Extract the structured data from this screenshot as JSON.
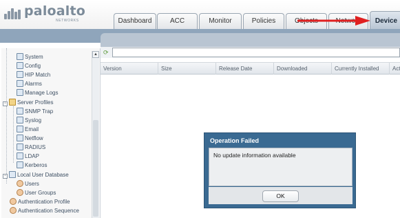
{
  "brand": {
    "name": "paloalto",
    "tagline": "NETWORKS"
  },
  "tabs": [
    "Dashboard",
    "ACC",
    "Monitor",
    "Policies",
    "Objects",
    "Network",
    "Device"
  ],
  "active_tab": "Device",
  "colors": {
    "header_band": "#8fa5bb",
    "modal": "#3a6a92",
    "annotation_arrow": "#e02020"
  },
  "sidebar": {
    "items": [
      {
        "label": "System",
        "icon": "document-icon"
      },
      {
        "label": "Config",
        "icon": "document-icon"
      },
      {
        "label": "HIP Match",
        "icon": "document-icon"
      },
      {
        "label": "Alarms",
        "icon": "document-icon"
      },
      {
        "label": "Manage Logs",
        "icon": "document-icon"
      },
      {
        "label": "Server Profiles",
        "icon": "folder-icon",
        "toggle": "−"
      },
      {
        "label": "SNMP Trap",
        "icon": "document-icon"
      },
      {
        "label": "Syslog",
        "icon": "document-icon"
      },
      {
        "label": "Email",
        "icon": "document-icon"
      },
      {
        "label": "Netflow",
        "icon": "document-icon"
      },
      {
        "label": "RADIUS",
        "icon": "document-icon"
      },
      {
        "label": "LDAP",
        "icon": "document-icon"
      },
      {
        "label": "Kerberos",
        "icon": "document-icon"
      },
      {
        "label": "Local User Database",
        "icon": "database-icon",
        "toggle": "−"
      },
      {
        "label": "Users",
        "icon": "user-icon"
      },
      {
        "label": "User Groups",
        "icon": "user-group-icon"
      },
      {
        "label": "Authentication Profile",
        "icon": "user-group-icon"
      },
      {
        "label": "Authentication Sequence",
        "icon": "user-group-icon"
      }
    ]
  },
  "grid": {
    "columns": [
      "Version",
      "Size",
      "Release Date",
      "Downloaded",
      "Currently Installed",
      "Action"
    ]
  },
  "dialog": {
    "title": "Operation Failed",
    "message": "No update information available",
    "ok_label": "OK"
  }
}
